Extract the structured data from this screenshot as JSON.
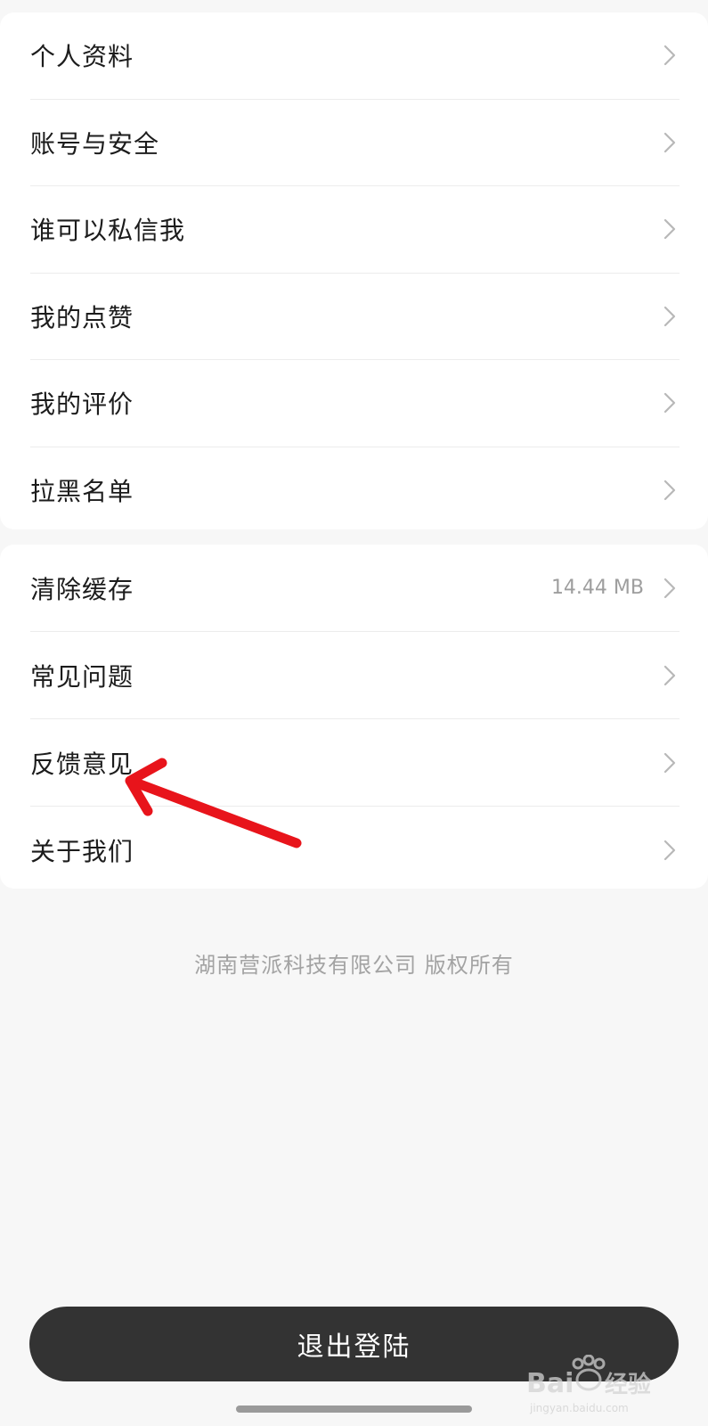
{
  "section1": {
    "items": [
      {
        "label": "个人资料"
      },
      {
        "label": "账号与安全"
      },
      {
        "label": "谁可以私信我"
      },
      {
        "label": "我的点赞"
      },
      {
        "label": "我的评价"
      },
      {
        "label": "拉黑名单"
      }
    ]
  },
  "section2": {
    "items": [
      {
        "label": "清除缓存",
        "value": "14.44 MB"
      },
      {
        "label": "常见问题"
      },
      {
        "label": "反馈意见"
      },
      {
        "label": "关于我们"
      }
    ]
  },
  "footer": {
    "copyright": "湖南营派科技有限公司 版权所有"
  },
  "logout": {
    "label": "退出登陆"
  },
  "annotation": {
    "arrow_color": "#e8141b",
    "points_to": "反馈意见"
  },
  "watermark": {
    "brand": "Bai du 经验",
    "url": "jingyan.baidu.com"
  },
  "colors": {
    "background": "#f7f7f7",
    "card": "#ffffff",
    "button": "#333333",
    "chevron": "#b8b8b8"
  }
}
